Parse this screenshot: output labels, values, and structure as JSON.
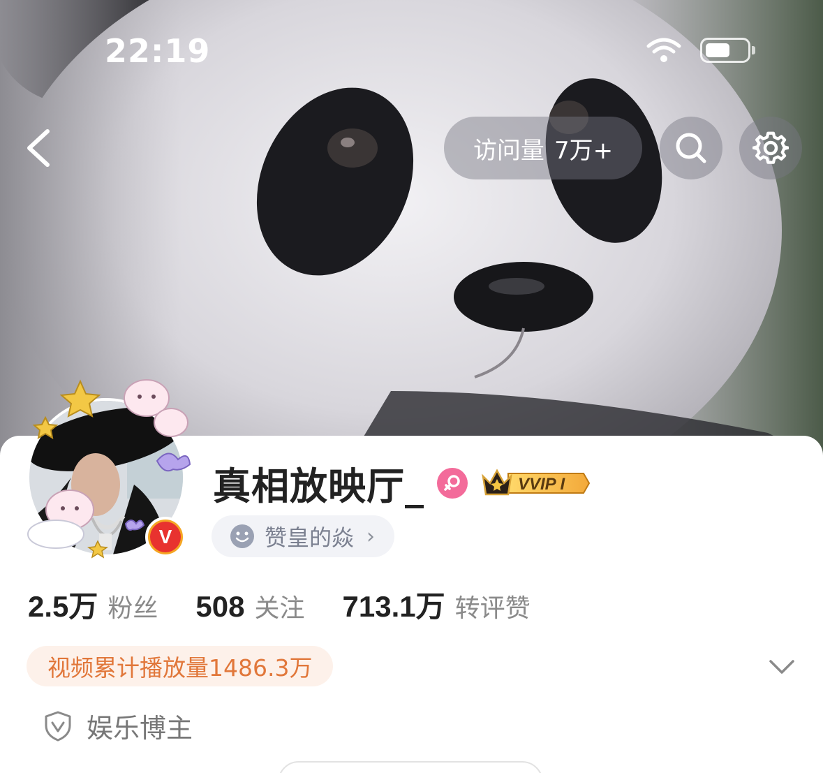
{
  "status_bar": {
    "time": "22:19",
    "wifi_icon": "wifi-icon",
    "battery_icon": "battery-icon",
    "battery_level": 0.5
  },
  "header": {
    "back_icon": "chevron-left-icon",
    "visits_label": "访问量",
    "visits_value": "7万+",
    "search_icon": "search-icon",
    "settings_icon": "gear-icon"
  },
  "profile": {
    "username": "真相放映厅_",
    "gender_icon": "female-icon",
    "vip_label": "VVIP I",
    "verified_icon": "verified-v-icon",
    "fanclub_label": "赞皇的焱"
  },
  "stats": [
    {
      "value": "2.5万",
      "label": "粉丝"
    },
    {
      "value": "508",
      "label": "关注"
    },
    {
      "value": "713.1万",
      "label": "转评赞"
    }
  ],
  "play_count": "视频累计播放量1486.3万",
  "category": "娱乐博主",
  "colors": {
    "accent_orange": "#e1773a",
    "verified_orange": "#f5a623",
    "gender_pink": "#f36b9a"
  }
}
